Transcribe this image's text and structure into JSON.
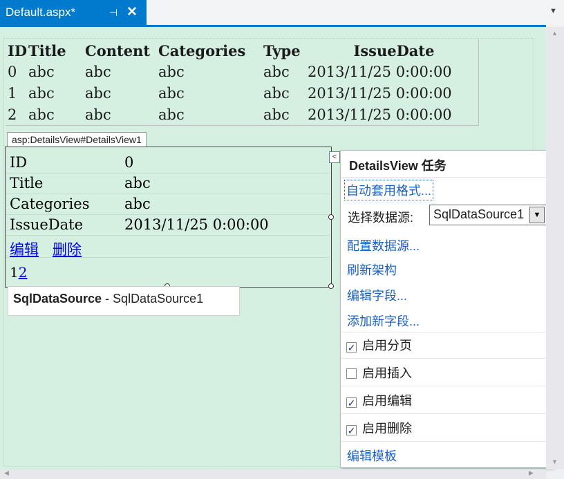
{
  "tab": {
    "title": "Default.aspx*",
    "pin_glyph": "⊣",
    "close_glyph": "✕"
  },
  "grid": {
    "columns": [
      "ID",
      "Title",
      "Content",
      "Categories",
      "Type",
      "IssueDate"
    ],
    "rows": [
      [
        "0",
        "abc",
        "abc",
        "abc",
        "abc",
        "2013/11/25 0:00:00"
      ],
      [
        "1",
        "abc",
        "abc",
        "abc",
        "abc",
        "2013/11/25 0:00:00"
      ],
      [
        "2",
        "abc",
        "abc",
        "abc",
        "abc",
        "2013/11/25 0:00:00"
      ]
    ]
  },
  "details_view": {
    "tag": "asp:DetailsView#DetailsView1",
    "fields": [
      {
        "key": "ID",
        "value": "0"
      },
      {
        "key": "Title",
        "value": "abc"
      },
      {
        "key": "Categories",
        "value": "abc"
      },
      {
        "key": "IssueDate",
        "value": "2013/11/25 0:00:00"
      }
    ],
    "edit_link": "编辑",
    "delete_link": "删除",
    "pager_current": "1",
    "pager_next": "2",
    "smart_tag_glyph": "<"
  },
  "sql_data_source": {
    "type": "SqlDataSource",
    "separator": " - ",
    "id": "SqlDataSource1"
  },
  "task_panel": {
    "title": "DetailsView 任务",
    "auto_format": "自动套用格式...",
    "choose_ds_label": "选择数据源:",
    "choose_ds_value": "SqlDataSource1",
    "configure_ds": "配置数据源...",
    "refresh_schema": "刷新架构",
    "edit_fields": "编辑字段...",
    "add_field": "添加新字段...",
    "checkboxes": [
      {
        "label": "启用分页",
        "checked": true
      },
      {
        "label": "启用插入",
        "checked": false
      },
      {
        "label": "启用编辑",
        "checked": true
      },
      {
        "label": "启用删除",
        "checked": true
      }
    ],
    "edit_templates": "编辑模板"
  }
}
